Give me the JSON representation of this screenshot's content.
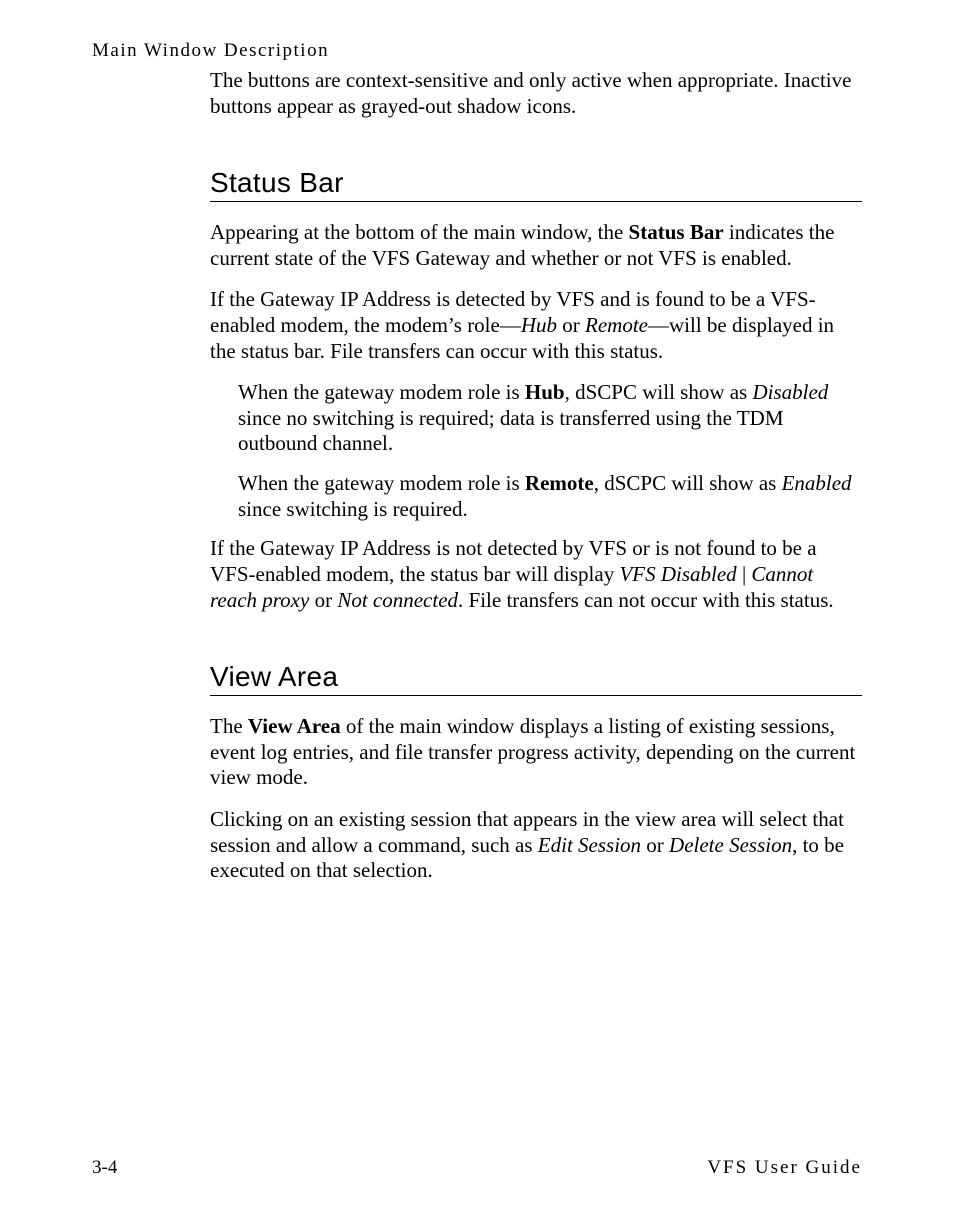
{
  "running_head": "Main Window Description",
  "intro_para_html": "The buttons are context-sensitive and only active when appropriate. Inactive buttons appear as grayed-out shadow icons.",
  "sections": {
    "status_bar": {
      "title": "Status Bar",
      "p1_html": "Appearing at the bottom of the main window, the <b>Status Bar</b> indicates the current state of the VFS Gateway and whether or not VFS is enabled.",
      "p2_html": "If the Gateway IP Address is detected by VFS and is found to be a VFS-enabled modem, the modem’s role—<i>Hub</i> or <i>Remote</i>—will be displayed in the status bar. File transfers can occur with this status.",
      "sub1_html": "When the gateway modem role is <b>Hub</b>, dSCPC will show as <i>Disabled</i> since no switching is required; data is transferred using the TDM outbound channel.",
      "sub2_html": "When the gateway modem role is <b>Remote</b>, dSCPC will show as <i>Enabled</i> since switching is required.",
      "p3_html": "If the Gateway IP Address is not detected by VFS or is not found to be a VFS-enabled modem, the status bar will display <i>VFS Disabled</i> | <i>Cannot reach proxy</i> or <i>Not connected</i>. File transfers can not occur with this status."
    },
    "view_area": {
      "title": "View Area",
      "p1_html": "The <b>View Area</b> of the main window displays a listing of existing sessions, event log entries, and file transfer progress activity, depending on the current view mode.",
      "p2_html": "Clicking on an existing session that appears in the view area will select that session and allow a command, such as <i>Edit Session</i> or <i>Delete Session</i>, to be executed on that selection."
    }
  },
  "footer": {
    "page_number": "3-4",
    "doc_title": "VFS User Guide"
  }
}
